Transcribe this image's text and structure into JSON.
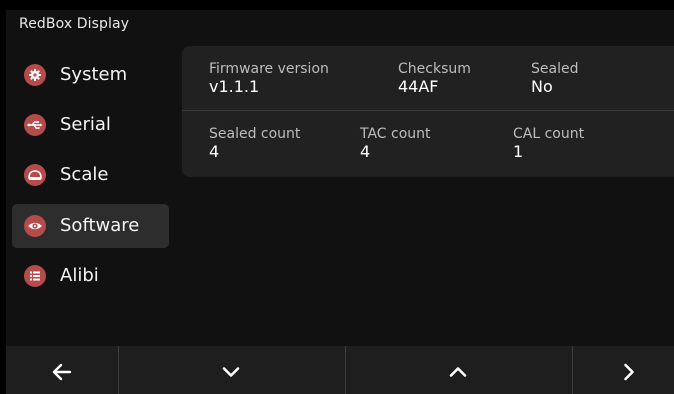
{
  "header": {
    "title": "RedBox Display"
  },
  "sidebar": {
    "items": [
      {
        "label": "System",
        "icon": "gear-icon"
      },
      {
        "label": "Serial",
        "icon": "usb-icon"
      },
      {
        "label": "Scale",
        "icon": "scale-icon"
      },
      {
        "label": "Software",
        "icon": "eye-icon",
        "active": true
      },
      {
        "label": "Alibi",
        "icon": "list-icon"
      }
    ]
  },
  "info": {
    "firmware_version": {
      "label": "Firmware version",
      "value": "v1.1.1"
    },
    "checksum": {
      "label": "Checksum",
      "value": "44AF"
    },
    "sealed": {
      "label": "Sealed",
      "value": "No"
    },
    "sealed_count": {
      "label": "Sealed count",
      "value": "4"
    },
    "tac_count": {
      "label": "TAC count",
      "value": "4"
    },
    "cal_count": {
      "label": "CAL count",
      "value": "1"
    }
  },
  "bottom_bar": {
    "buttons": [
      {
        "icon": "arrow-left-icon"
      },
      {
        "icon": "chevron-down-icon"
      },
      {
        "icon": "chevron-up-icon"
      },
      {
        "icon": "chevron-right-icon"
      }
    ]
  },
  "colors": {
    "accent": "#b64b4b",
    "background": "#111111",
    "panel": "#212121",
    "active_item": "#2d2d2d",
    "bottom_bar": "#1e1e1e"
  }
}
